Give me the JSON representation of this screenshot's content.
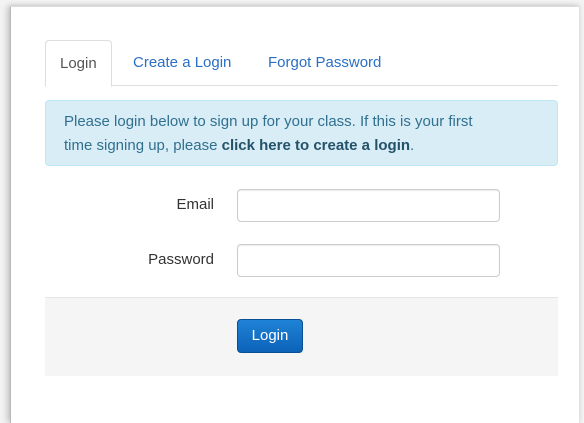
{
  "tabs": [
    {
      "label": "Login",
      "active": true
    },
    {
      "label": "Create a Login",
      "active": false
    },
    {
      "label": "Forgot Password",
      "active": false
    }
  ],
  "alert": {
    "line1": "Please login below to sign up for your class. If this is your first",
    "line2_prefix": "time signing up, please ",
    "link_text": "click here to create a login",
    "line2_suffix": "."
  },
  "form": {
    "email_label": "Email",
    "email_value": "",
    "password_label": "Password",
    "password_value": ""
  },
  "footer": {
    "login_button": "Login"
  },
  "colors": {
    "link": "#2a6fc4",
    "alert_bg": "#d9edf7",
    "alert_text": "#31708f",
    "button": "#0c63b8"
  }
}
